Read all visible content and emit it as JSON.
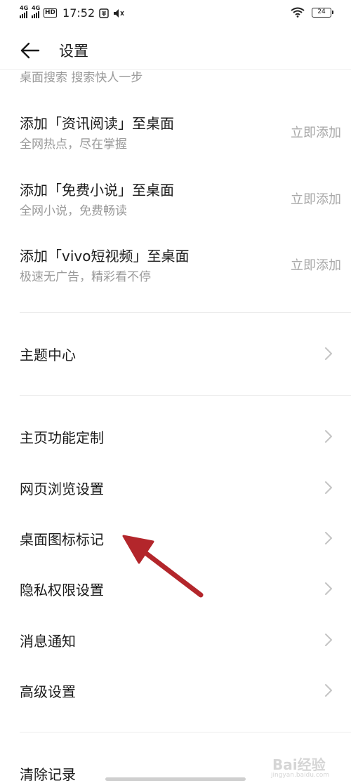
{
  "status_bar": {
    "sim1": "4G",
    "sim2": "4G",
    "hd": "HD",
    "time": "17:52",
    "battery": "24"
  },
  "header": {
    "title": "设置"
  },
  "clipped_text": "桌面搜索 搜索快人一步",
  "promo_items": [
    {
      "title": "添加「资讯阅读」至桌面",
      "subtitle": "全网热点，尽在掌握",
      "action": "立即添加"
    },
    {
      "title": "添加「免费小说」至桌面",
      "subtitle": "全网小说，免费畅读",
      "action": "立即添加"
    },
    {
      "title": "添加「vivo短视频」至桌面",
      "subtitle": "极速无广告，精彩看不停",
      "action": "立即添加"
    }
  ],
  "theme_item": {
    "label": "主题中心"
  },
  "settings_items": [
    {
      "label": "主页功能定制"
    },
    {
      "label": "网页浏览设置"
    },
    {
      "label": "桌面图标标记"
    },
    {
      "label": "隐私权限设置"
    },
    {
      "label": "消息通知"
    },
    {
      "label": "高级设置"
    }
  ],
  "clear_item": {
    "label": "清除记录"
  },
  "annotation": {
    "arrow_color": "#b3262b"
  },
  "watermark": {
    "text": "Bai经验",
    "sub": "jingyan.baidu.com"
  }
}
